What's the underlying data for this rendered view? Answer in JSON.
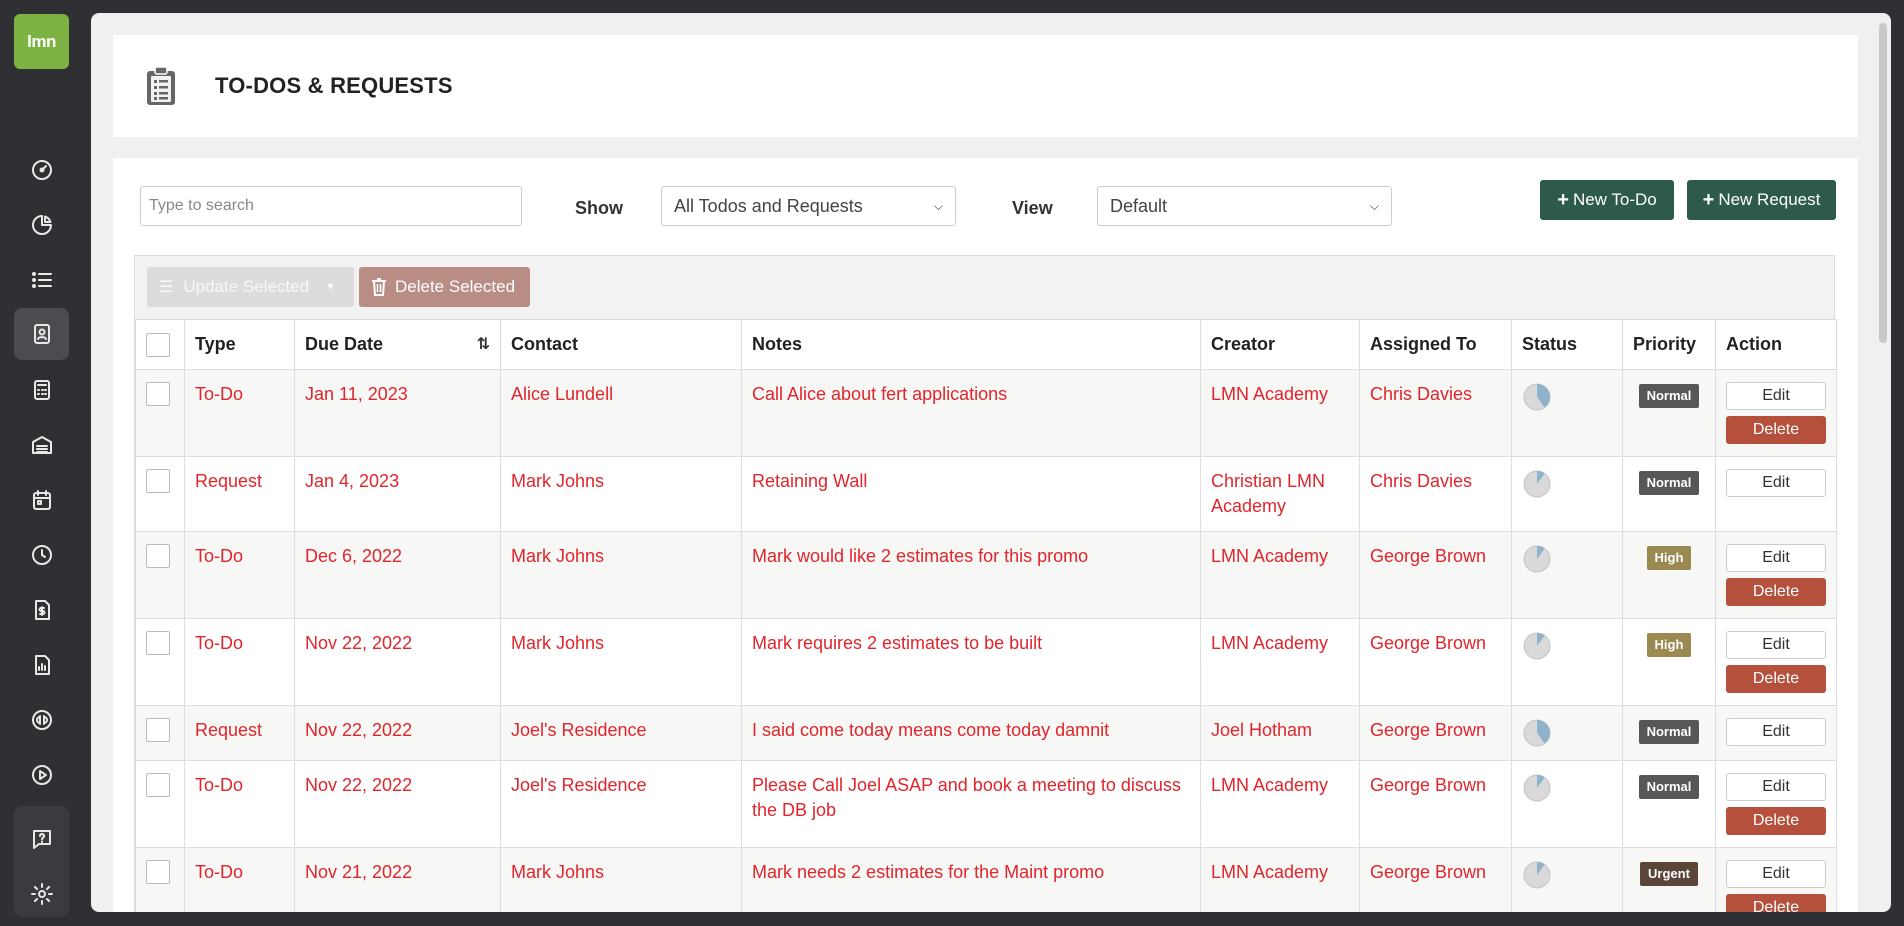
{
  "app": {
    "logo_text": "lmn"
  },
  "nav": {
    "items": [
      {
        "icon": "dashboard-icon"
      },
      {
        "icon": "pie-chart-icon"
      },
      {
        "icon": "list-icon"
      },
      {
        "icon": "contact-card-icon",
        "active": true
      },
      {
        "icon": "calculator-icon"
      },
      {
        "icon": "warehouse-icon"
      },
      {
        "icon": "calendar-icon"
      },
      {
        "icon": "clock-icon"
      },
      {
        "icon": "invoice-icon"
      },
      {
        "icon": "report-icon"
      },
      {
        "icon": "quickbooks-icon"
      },
      {
        "icon": "play-icon"
      },
      {
        "icon": "help-icon"
      },
      {
        "icon": "settings-icon"
      }
    ]
  },
  "header": {
    "title": "TO-DOS & REQUESTS",
    "icon": "clipboard-icon"
  },
  "toolbar": {
    "search_placeholder": "Type to search",
    "show_label": "Show",
    "show_value": "All Todos and Requests",
    "view_label": "View",
    "view_value": "Default",
    "new_todo_label": "New To-Do",
    "new_request_label": "New Request",
    "update_selected_label": "Update Selected",
    "delete_selected_label": "Delete Selected"
  },
  "table": {
    "columns": [
      "Type",
      "Due Date",
      "Contact",
      "Notes",
      "Creator",
      "Assigned To",
      "Status",
      "Priority",
      "Action"
    ],
    "edit_label": "Edit",
    "delete_label": "Delete",
    "rows": [
      {
        "type": "To-Do",
        "due": "Jan 11, 2023",
        "contact": "Alice Lundell",
        "notes": "Call Alice about fert applications",
        "creator": "LMN Academy",
        "assigned": "Chris Davies",
        "status_progress": 0.4,
        "priority": "Normal",
        "can_delete": true
      },
      {
        "type": "Request",
        "due": "Jan 4, 2023",
        "contact": "Mark Johns",
        "notes": "Retaining Wall",
        "creator": "Christian LMN Academy",
        "assigned": "Chris Davies",
        "status_progress": 0.1,
        "priority": "Normal",
        "can_delete": false
      },
      {
        "type": "To-Do",
        "due": "Dec 6, 2022",
        "contact": "Mark Johns",
        "notes": "Mark would like 2 estimates for this promo",
        "creator": "LMN Academy",
        "assigned": "George Brown",
        "status_progress": 0.1,
        "priority": "High",
        "can_delete": true
      },
      {
        "type": "To-Do",
        "due": "Nov 22, 2022",
        "contact": "Mark Johns",
        "notes": "Mark requires 2 estimates to be built",
        "creator": "LMN Academy",
        "assigned": "George Brown",
        "status_progress": 0.1,
        "priority": "High",
        "can_delete": true
      },
      {
        "type": "Request",
        "due": "Nov 22, 2022",
        "contact": "Joel's Residence",
        "notes": "I said come today means come today damnit",
        "creator": "Joel Hotham",
        "assigned": "George Brown",
        "status_progress": 0.4,
        "priority": "Normal",
        "can_delete": false
      },
      {
        "type": "To-Do",
        "due": "Nov 22, 2022",
        "contact": "Joel's Residence",
        "notes": "Please Call Joel ASAP and book a meeting to discuss the DB job",
        "creator": "LMN Academy",
        "assigned": "George Brown",
        "status_progress": 0.1,
        "priority": "Normal",
        "can_delete": true
      },
      {
        "type": "To-Do",
        "due": "Nov 21, 2022",
        "contact": "Mark Johns",
        "notes": "Mark needs 2 estimates for the Maint promo",
        "creator": "LMN Academy",
        "assigned": "George Brown",
        "status_progress": 0.1,
        "priority": "Urgent",
        "can_delete": true
      }
    ]
  }
}
